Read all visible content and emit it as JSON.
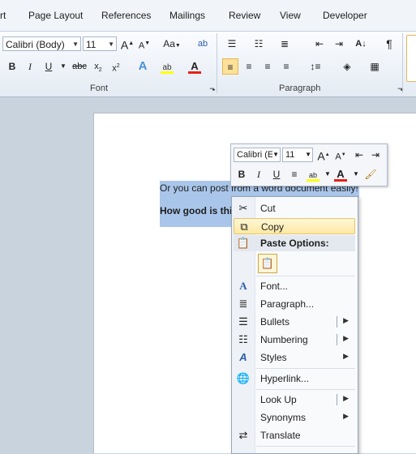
{
  "tabs": [
    "rt",
    "Page Layout",
    "References",
    "Mailings",
    "Review",
    "View",
    "Developer"
  ],
  "ribbon": {
    "font_name": "Calibri (Body)",
    "font_size": "11",
    "group_font": "Font",
    "group_paragraph": "Paragraph",
    "bold": "B",
    "italic": "I",
    "underline": "U",
    "strike": "abc",
    "grow": "A",
    "shrink": "A",
    "change_case": "Aa",
    "pilcrow": "¶"
  },
  "document": {
    "line1": "Or you can post from a word document easily!",
    "line2": "How good is this"
  },
  "mini_toolbar": {
    "font_name": "Calibri (E",
    "font_size": "11",
    "bold": "B",
    "italic": "I",
    "underline": "U"
  },
  "context_menu": {
    "cut": "Cut",
    "copy": "Copy",
    "paste_options": "Paste Options:",
    "font": "Font...",
    "paragraph": "Paragraph...",
    "bullets": "Bullets",
    "numbering": "Numbering",
    "styles": "Styles",
    "hyperlink": "Hyperlink...",
    "look_up": "Look Up",
    "synonyms": "Synonyms",
    "translate": "Translate"
  },
  "colors": {
    "selection": "#a9c6ea",
    "highlight_yellow": "#ffff00",
    "font_red": "#e8201a",
    "menu_hover": "#fde9a4"
  }
}
